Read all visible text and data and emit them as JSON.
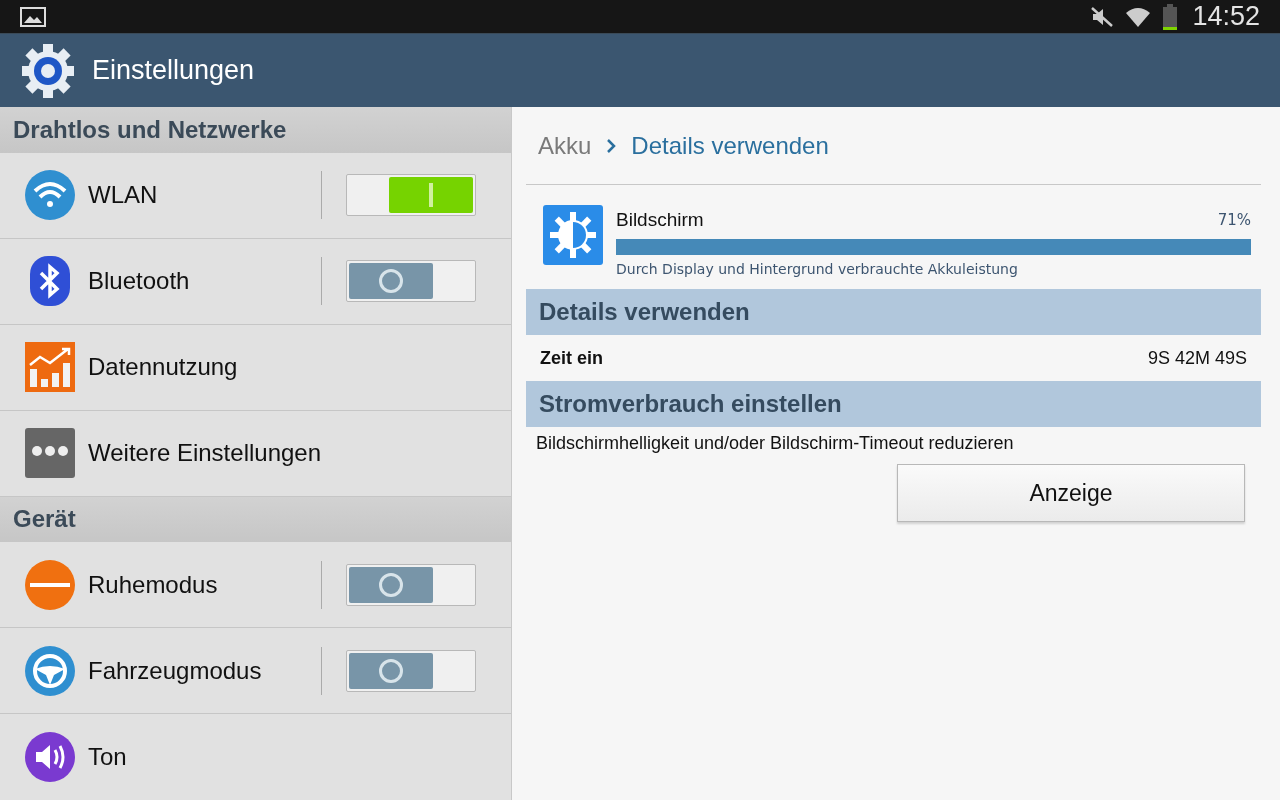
{
  "status_bar": {
    "time": "14:52"
  },
  "app_bar": {
    "title": "Einstellungen"
  },
  "sidebar": {
    "sections": [
      {
        "title": "Drahtlos und Netzwerke",
        "items": [
          {
            "label": "WLAN",
            "kind": "toggle",
            "on": true
          },
          {
            "label": "Bluetooth",
            "kind": "toggle",
            "on": false
          },
          {
            "label": "Datennutzung",
            "kind": "plain"
          },
          {
            "label": "Weitere Einstellungen",
            "kind": "plain"
          }
        ]
      },
      {
        "title": "Gerät",
        "items": [
          {
            "label": "Ruhemodus",
            "kind": "toggle",
            "on": false
          },
          {
            "label": "Fahrzeugmodus",
            "kind": "toggle",
            "on": false
          },
          {
            "label": "Ton",
            "kind": "plain"
          }
        ]
      }
    ]
  },
  "detail": {
    "breadcrumb": {
      "parent": "Akku",
      "current": "Details verwenden"
    },
    "usage": {
      "name": "Bildschirm",
      "percent": "71%",
      "level": 1,
      "description": "Durch Display und Hintergrund verbrauchte Akkuleistung"
    },
    "sections": [
      {
        "title": "Details verwenden",
        "kind": "row",
        "label": "Zeit ein",
        "value": "9S 42M 49S"
      },
      {
        "title": "Stromverbrauch einstellen",
        "kind": "action",
        "text": "Bildschirmhelligkeit und/oder Bildschirm-Timeout reduzieren",
        "button": "Anzeige"
      }
    ]
  }
}
